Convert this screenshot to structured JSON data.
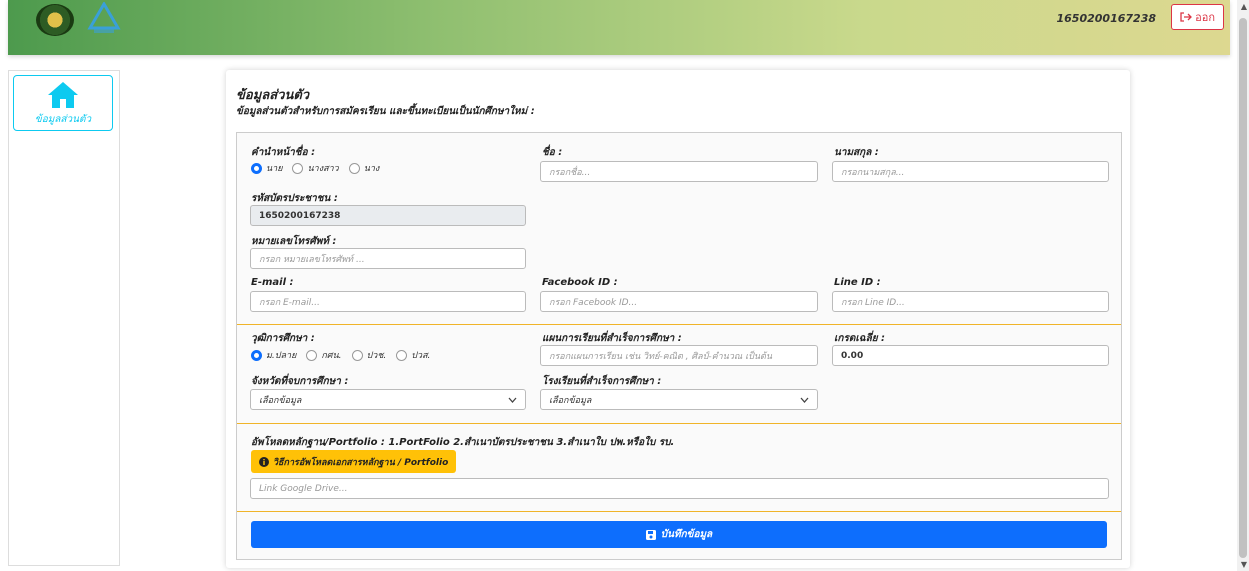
{
  "header": {
    "user_id": "1650200167238",
    "logout_label": "ออก"
  },
  "sidebar": {
    "items": [
      {
        "label": "ข้อมูลส่วนตัว",
        "icon": "home-icon"
      }
    ]
  },
  "card": {
    "title": "ข้อมูลส่วนตัว",
    "subtitle": "ข้อมูลส่วนตัวสำหรับการสมัครเรียน และขึ้นทะเบียนเป็นนักศึกษาใหม่ :"
  },
  "form": {
    "prefix_label": "คำนำหน้าชื่อ :",
    "prefix_options": [
      "นาย",
      "นางสาว",
      "นาง"
    ],
    "prefix_selected": "นาย",
    "firstname_label": "ชื่อ :",
    "firstname_placeholder": "กรอกชื่อ...",
    "lastname_label": "นามสกุล :",
    "lastname_placeholder": "กรอกนามสกุล...",
    "citizen_id_label": "รหัสบัตรประชาชน :",
    "citizen_id_value": "1650200167238",
    "phone_label": "หมายเลขโทรศัพท์ :",
    "phone_placeholder": "กรอก หมายเลขโทรศัพท์ ...",
    "email_label": "E-mail :",
    "email_placeholder": "กรอก E-mail...",
    "facebook_label": "Facebook ID :",
    "facebook_placeholder": "กรอก Facebook ID...",
    "line_label": "Line ID :",
    "line_placeholder": "กรอก Line ID...",
    "education_label": "วุฒิการศึกษา :",
    "education_options": [
      "ม.ปลาย",
      "กศน.",
      "ปวช.",
      "ปวส."
    ],
    "education_selected": "ม.ปลาย",
    "study_plan_label": "แผนการเรียนที่สำเร็จการศึกษา :",
    "study_plan_placeholder": "กรอกแผนการเรียน เช่น วิทย์-คณิต , ศิลป์-คำนวณ เป็นต้น",
    "gpa_label": "เกรดเฉลี่ย :",
    "gpa_value": "0.00",
    "province_label": "จังหวัดที่จบการศึกษา :",
    "province_selected": "เลือกข้อมูล",
    "school_label": "โรงเรียนที่สำเร็จการศึกษา :",
    "school_selected": "เลือกข้อมูล",
    "upload_label": "อัพโหลดหลักฐาน/Portfolio : 1.PortFolio 2.สำเนาบัตรประชาชน 3.สำเนาใบ ปพ.หรือใบ รบ.",
    "upload_help_label": "วิธีการอัพโหลดเอกสารหลักฐาน / Portfolio",
    "drive_placeholder": "Link Google Drive...",
    "save_label": "บันทึกข้อมูล"
  },
  "colors": {
    "primary": "#0d6efd",
    "info": "#0dcaf0",
    "warning": "#ffc107",
    "danger": "#dc3545",
    "divider": "#f0b429"
  }
}
